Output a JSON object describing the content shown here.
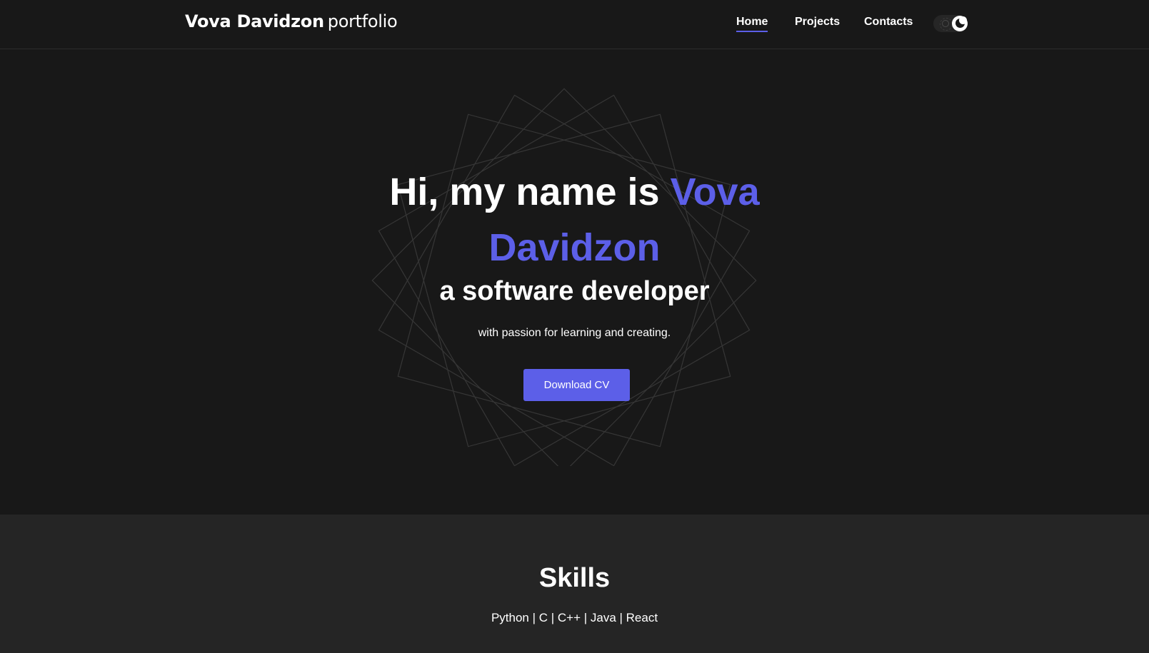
{
  "header": {
    "brand_name": "Vova Davidzon",
    "brand_suffix": "portfolio",
    "nav": [
      {
        "label": "Home",
        "active": true
      },
      {
        "label": "Projects",
        "active": false
      },
      {
        "label": "Contacts",
        "active": false
      }
    ],
    "theme_toggle": {
      "mode": "dark",
      "icons": [
        "sun-icon",
        "moon-icon"
      ]
    }
  },
  "hero": {
    "greeting": "Hi, my name is",
    "name_first": "Vova",
    "name_last": "Davidzon",
    "subtitle": "a software developer",
    "tagline": "with passion for learning and creating.",
    "cta_label": "Download CV"
  },
  "skills": {
    "title": "Skills",
    "list": "Python | C | C++ | Java | React"
  },
  "colors": {
    "background": "#181818",
    "section_background": "#252525",
    "accent": "#5c5fe8",
    "text": "#ffffff"
  }
}
